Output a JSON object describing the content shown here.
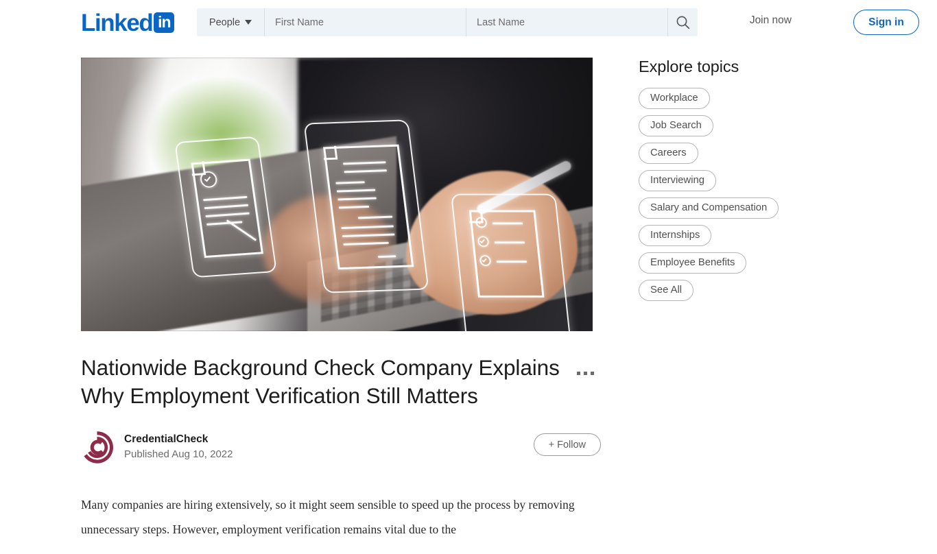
{
  "header": {
    "logo_word": "Linked",
    "logo_badge": "in",
    "search": {
      "facet_label": "People",
      "first_name_placeholder": "First Name",
      "first_name_value": "",
      "last_name_placeholder": "Last Name",
      "last_name_value": "",
      "search_icon": "search-icon"
    },
    "join_now_label": "Join now",
    "sign_in_label": "Sign in",
    "accent_color": "#0A66C2"
  },
  "article": {
    "hero_alt": "Person using stylus on laptop with floating holographic document and checklist icons",
    "title": "Nationwide Background Check Company Explains Why Employment Verification Still Matters",
    "more_menu_icon": "ellipsis-icon",
    "author": {
      "name": "CredentialCheck",
      "published": "Published Aug 10, 2022",
      "avatar_icon": "credentialcheck-logo-icon",
      "avatar_color": "#8E2B49"
    },
    "follow_label": "+ Follow",
    "body_paragraph": "Many companies are hiring extensively, so it might seem sensible to speed up the process by removing unnecessary steps. However, employment verification remains vital due to the"
  },
  "sidebar": {
    "title": "Explore topics",
    "topics": [
      {
        "label": "Workplace"
      },
      {
        "label": "Job Search"
      },
      {
        "label": "Careers"
      },
      {
        "label": "Interviewing"
      },
      {
        "label": "Salary and Compensation"
      },
      {
        "label": "Internships"
      },
      {
        "label": "Employee Benefits"
      },
      {
        "label": "See All"
      }
    ]
  }
}
